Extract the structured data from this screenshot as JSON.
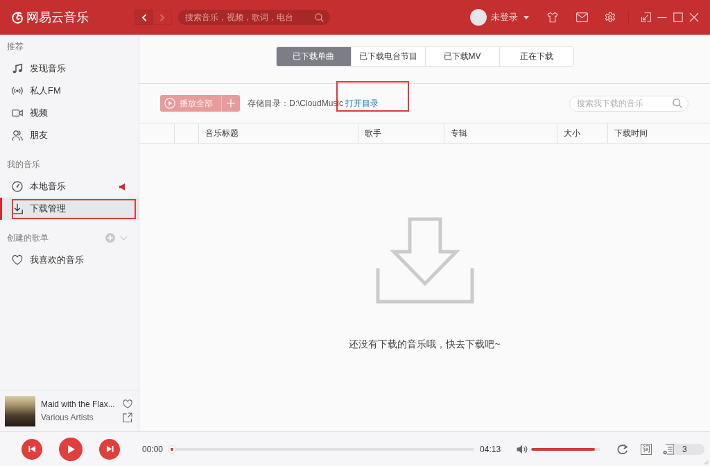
{
  "title_bar": {
    "app_name": "网易云音乐",
    "nav_buttons": [
      {
        "kind": "back",
        "disabled": false
      },
      {
        "kind": "forward",
        "disabled": true
      }
    ],
    "search": {
      "placeholder": "搜索音乐，视频，歌词，电台"
    },
    "user": {
      "name": "未登录"
    }
  },
  "sidebar": {
    "sections": [
      {
        "title": "推荐",
        "kind": "plain",
        "items": [
          {
            "label": "发现音乐",
            "kind": "discover",
            "selected": false,
            "playing": false,
            "highlighted": false
          },
          {
            "label": "私人FM",
            "kind": "fm",
            "selected": false,
            "playing": false,
            "highlighted": false
          },
          {
            "label": "视频",
            "kind": "video",
            "selected": false,
            "playing": false,
            "highlighted": false
          },
          {
            "label": "朋友",
            "kind": "friends",
            "selected": false,
            "playing": false,
            "highlighted": false
          }
        ]
      },
      {
        "title": "我的音乐",
        "kind": "plain",
        "items": [
          {
            "label": "本地音乐",
            "kind": "local",
            "selected": false,
            "playing": true,
            "highlighted": false
          },
          {
            "label": "下载管理",
            "kind": "download",
            "selected": true,
            "playing": false,
            "highlighted": true
          }
        ]
      },
      {
        "title": "创建的歌单",
        "kind": "playlists",
        "items": [
          {
            "label": "我喜欢的音乐",
            "kind": "liked",
            "selected": false,
            "playing": false,
            "highlighted": false
          }
        ]
      }
    ]
  },
  "now_playing": {
    "title": "Maid with the Flax...",
    "artist": "Various Artists",
    "liked": false
  },
  "download_view": {
    "tabs": [
      {
        "label": "已下载单曲",
        "selected": true
      },
      {
        "label": "已下载电台节目",
        "selected": false
      },
      {
        "label": "已下载MV",
        "selected": false
      },
      {
        "label": "正在下载",
        "selected": false
      }
    ],
    "toolbar": {
      "play_all": {
        "label": "播放全部",
        "disabled": true
      },
      "storage_path": "存储目录：D:\\CloudMusic",
      "open_folder": {
        "label": "打开目录",
        "highlighted": true
      },
      "search": {
        "placeholder": "搜索我下载的音乐"
      }
    },
    "table": {
      "columns": [
        {
          "label": "音乐标题"
        },
        {
          "label": "歌手"
        },
        {
          "label": "专辑"
        },
        {
          "label": "大小"
        },
        {
          "label": "下载时间"
        }
      ]
    },
    "empty_state": {
      "message": "还没有下载的音乐哦，快去下载吧~"
    }
  },
  "player": {
    "elapsed": "00:00",
    "progress": {
      "level": 0
    },
    "duration": "04:13",
    "volume": {
      "level": 0.92
    },
    "lyrics_toggle": "词",
    "playlist_count": "3"
  }
}
